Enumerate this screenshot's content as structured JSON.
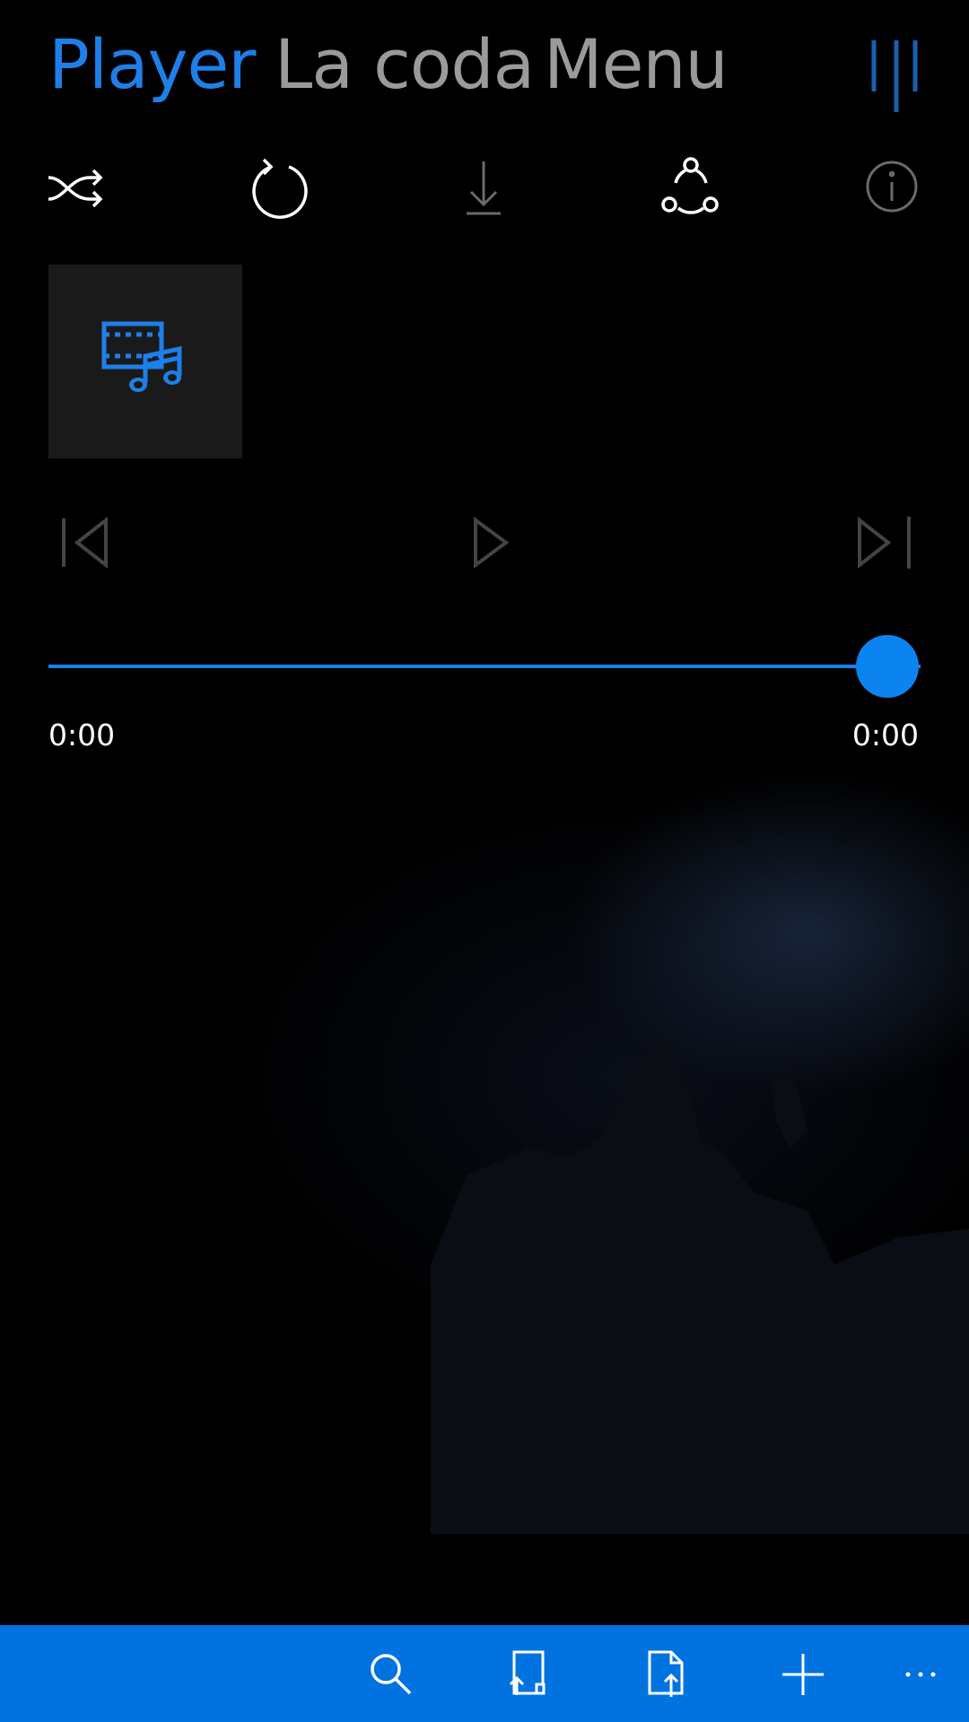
{
  "pivot": {
    "tabs": [
      {
        "label": "Player",
        "active": true
      },
      {
        "label": "La coda",
        "active": false
      },
      {
        "label": "Menu",
        "active": false
      }
    ],
    "menu_icon": "hamburger-icon"
  },
  "toolbar": {
    "icons": [
      "shuffle-icon",
      "repeat-icon",
      "download-icon",
      "share-icon",
      "info-icon"
    ]
  },
  "album_art": {
    "icon": "video-music-icon"
  },
  "transport": {
    "icons": [
      "previous-icon",
      "play-icon",
      "next-icon"
    ]
  },
  "seek": {
    "elapsed": "0:00",
    "duration": "0:00",
    "progress_fraction": 1.0
  },
  "appbar": {
    "icons": [
      "search-icon",
      "open-file-icon",
      "upload-file-icon",
      "add-icon",
      "more-icon"
    ]
  },
  "colors": {
    "accent": "#1e7fe8",
    "appbar": "#0173e0",
    "background": "#000000",
    "inactive_tab": "#9a9a9a"
  }
}
